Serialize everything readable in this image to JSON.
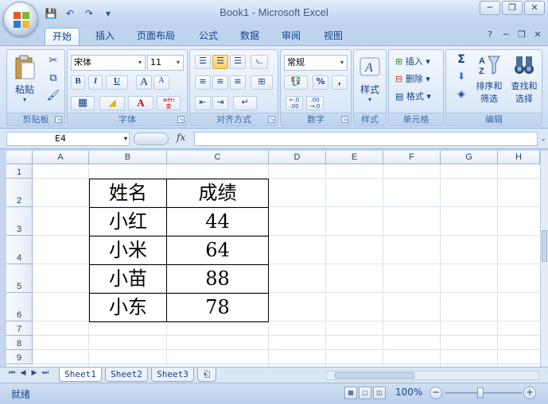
{
  "window": {
    "title": "Book1 - Microsoft Excel",
    "controls": [
      "─",
      "❐",
      "✕"
    ]
  },
  "qat": {
    "save_icon": "💾",
    "undo_icon": "↶",
    "redo_icon": "↷",
    "customize_icon": "▾"
  },
  "tabs": [
    {
      "label": "开始",
      "active": true
    },
    {
      "label": "插入"
    },
    {
      "label": "页面布局"
    },
    {
      "label": "公式"
    },
    {
      "label": "数据"
    },
    {
      "label": "审阅"
    },
    {
      "label": "视图"
    }
  ],
  "tab_right": {
    "help": "?",
    "minimize": "─",
    "restore": "❐",
    "close": "✕"
  },
  "ribbon": {
    "clipboard": {
      "label": "剪贴板",
      "paste": "粘贴",
      "cut_icon": "✂",
      "copy_icon": "⧉",
      "format_painter_icon": "🖌"
    },
    "font": {
      "label": "字体",
      "font_name": "宋体",
      "font_size": "11",
      "grow": "A",
      "shrink": "A",
      "bold": "B",
      "italic": "I",
      "underline": "U",
      "border_icon": "▦",
      "fill_icon": "◢",
      "font_color": "A",
      "phonetic": "wén\n变"
    },
    "alignment": {
      "label": "对齐方式"
    },
    "number": {
      "label": "数字",
      "format": "常规",
      "currency_icon": "💱",
      "percent": "%",
      "comma": ",",
      "inc_decimal": "←.0\n.00",
      "dec_decimal": ".00\n→.0"
    },
    "styles": {
      "label": "样式",
      "button": "样式"
    },
    "cells": {
      "label": "单元格",
      "insert": "插入",
      "delete": "删除",
      "format": "格式"
    },
    "editing": {
      "label": "编辑",
      "sum_icon": "Σ",
      "fill_icon": "⬇",
      "clear_icon": "◈",
      "sort": "排序和",
      "sort2": "筛选",
      "find": "查找和",
      "find2": "选择"
    }
  },
  "formula_bar": {
    "name_box": "E4",
    "fx": "fx",
    "value": ""
  },
  "columns": [
    "A",
    "B",
    "C",
    "D",
    "E",
    "F",
    "G",
    "H"
  ],
  "rows": [
    "1",
    "2",
    "3",
    "4",
    "5",
    "6",
    "7",
    "8",
    "9"
  ],
  "table": {
    "headers": [
      "姓名",
      "成绩"
    ],
    "rows": [
      [
        "小红",
        "44"
      ],
      [
        "小米",
        "64"
      ],
      [
        "小苗",
        "88"
      ],
      [
        "小东",
        "78"
      ]
    ]
  },
  "sheets": [
    "Sheet1",
    "Sheet2",
    "Sheet3"
  ],
  "status": {
    "text": "就绪",
    "zoom": "100%"
  }
}
